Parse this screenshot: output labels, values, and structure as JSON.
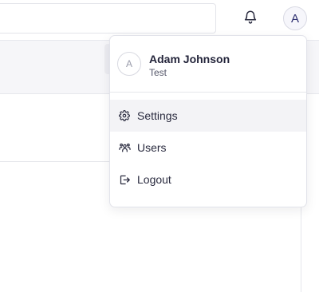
{
  "topbar": {
    "search_placeholder": "",
    "avatar_initial": "A"
  },
  "user_menu": {
    "avatar_initial": "A",
    "name": "Adam Johnson",
    "role": "Test",
    "items": [
      {
        "label": "Settings",
        "icon": "gear-icon"
      },
      {
        "label": "Users",
        "icon": "users-icon"
      },
      {
        "label": "Logout",
        "icon": "logout-icon"
      }
    ]
  }
}
